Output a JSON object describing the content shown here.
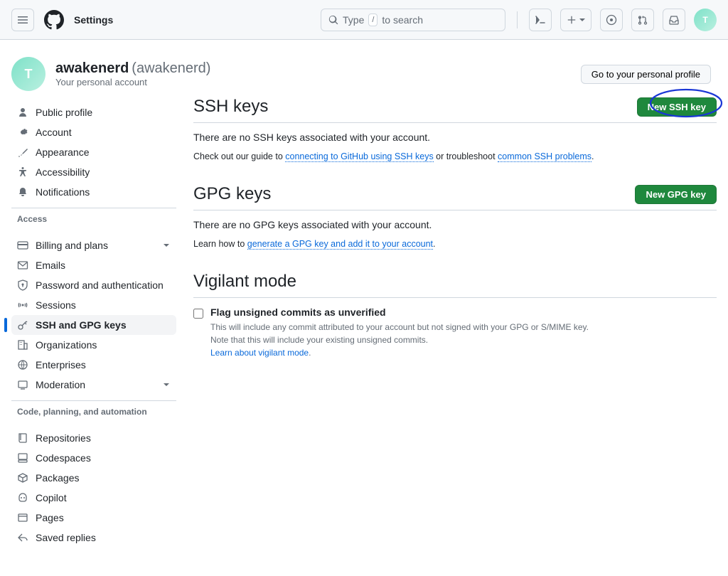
{
  "topbar": {
    "title": "Settings",
    "search_placeholder": "Type",
    "search_hint": "to search",
    "avatar_initials": "T"
  },
  "header": {
    "display_name": "awakenerd",
    "login": "(awakenerd)",
    "subtitle": "Your personal account",
    "profile_button": "Go to your personal profile",
    "avatar_initials": "T"
  },
  "sidebar": {
    "group1": [
      {
        "label": "Public profile"
      },
      {
        "label": "Account"
      },
      {
        "label": "Appearance"
      },
      {
        "label": "Accessibility"
      },
      {
        "label": "Notifications"
      }
    ],
    "access_heading": "Access",
    "access": [
      {
        "label": "Billing and plans",
        "chevron": true
      },
      {
        "label": "Emails"
      },
      {
        "label": "Password and authentication"
      },
      {
        "label": "Sessions"
      },
      {
        "label": "SSH and GPG keys",
        "active": true
      },
      {
        "label": "Organizations"
      },
      {
        "label": "Enterprises"
      },
      {
        "label": "Moderation",
        "chevron": true
      }
    ],
    "code_heading": "Code, planning, and automation",
    "code": [
      {
        "label": "Repositories"
      },
      {
        "label": "Codespaces"
      },
      {
        "label": "Packages"
      },
      {
        "label": "Copilot"
      },
      {
        "label": "Pages"
      },
      {
        "label": "Saved replies"
      }
    ]
  },
  "ssh": {
    "title": "SSH keys",
    "button": "New SSH key",
    "empty": "There are no SSH keys associated with your account.",
    "hint_prefix": "Check out our guide to ",
    "hint_link1": "connecting to GitHub using SSH keys",
    "hint_mid": " or troubleshoot ",
    "hint_link2": "common SSH problems",
    "hint_suffix": "."
  },
  "gpg": {
    "title": "GPG keys",
    "button": "New GPG key",
    "empty": "There are no GPG keys associated with your account.",
    "hint_prefix": "Learn how to ",
    "hint_link": "generate a GPG key and add it to your account",
    "hint_suffix": "."
  },
  "vigilant": {
    "title": "Vigilant mode",
    "checkbox_label": "Flag unsigned commits as unverified",
    "desc_line1": "This will include any commit attributed to your account but not signed with your GPG or S/MIME key.",
    "desc_line2": "Note that this will include your existing unsigned commits.",
    "learn_link": "Learn about vigilant mode",
    "learn_suffix": "."
  }
}
